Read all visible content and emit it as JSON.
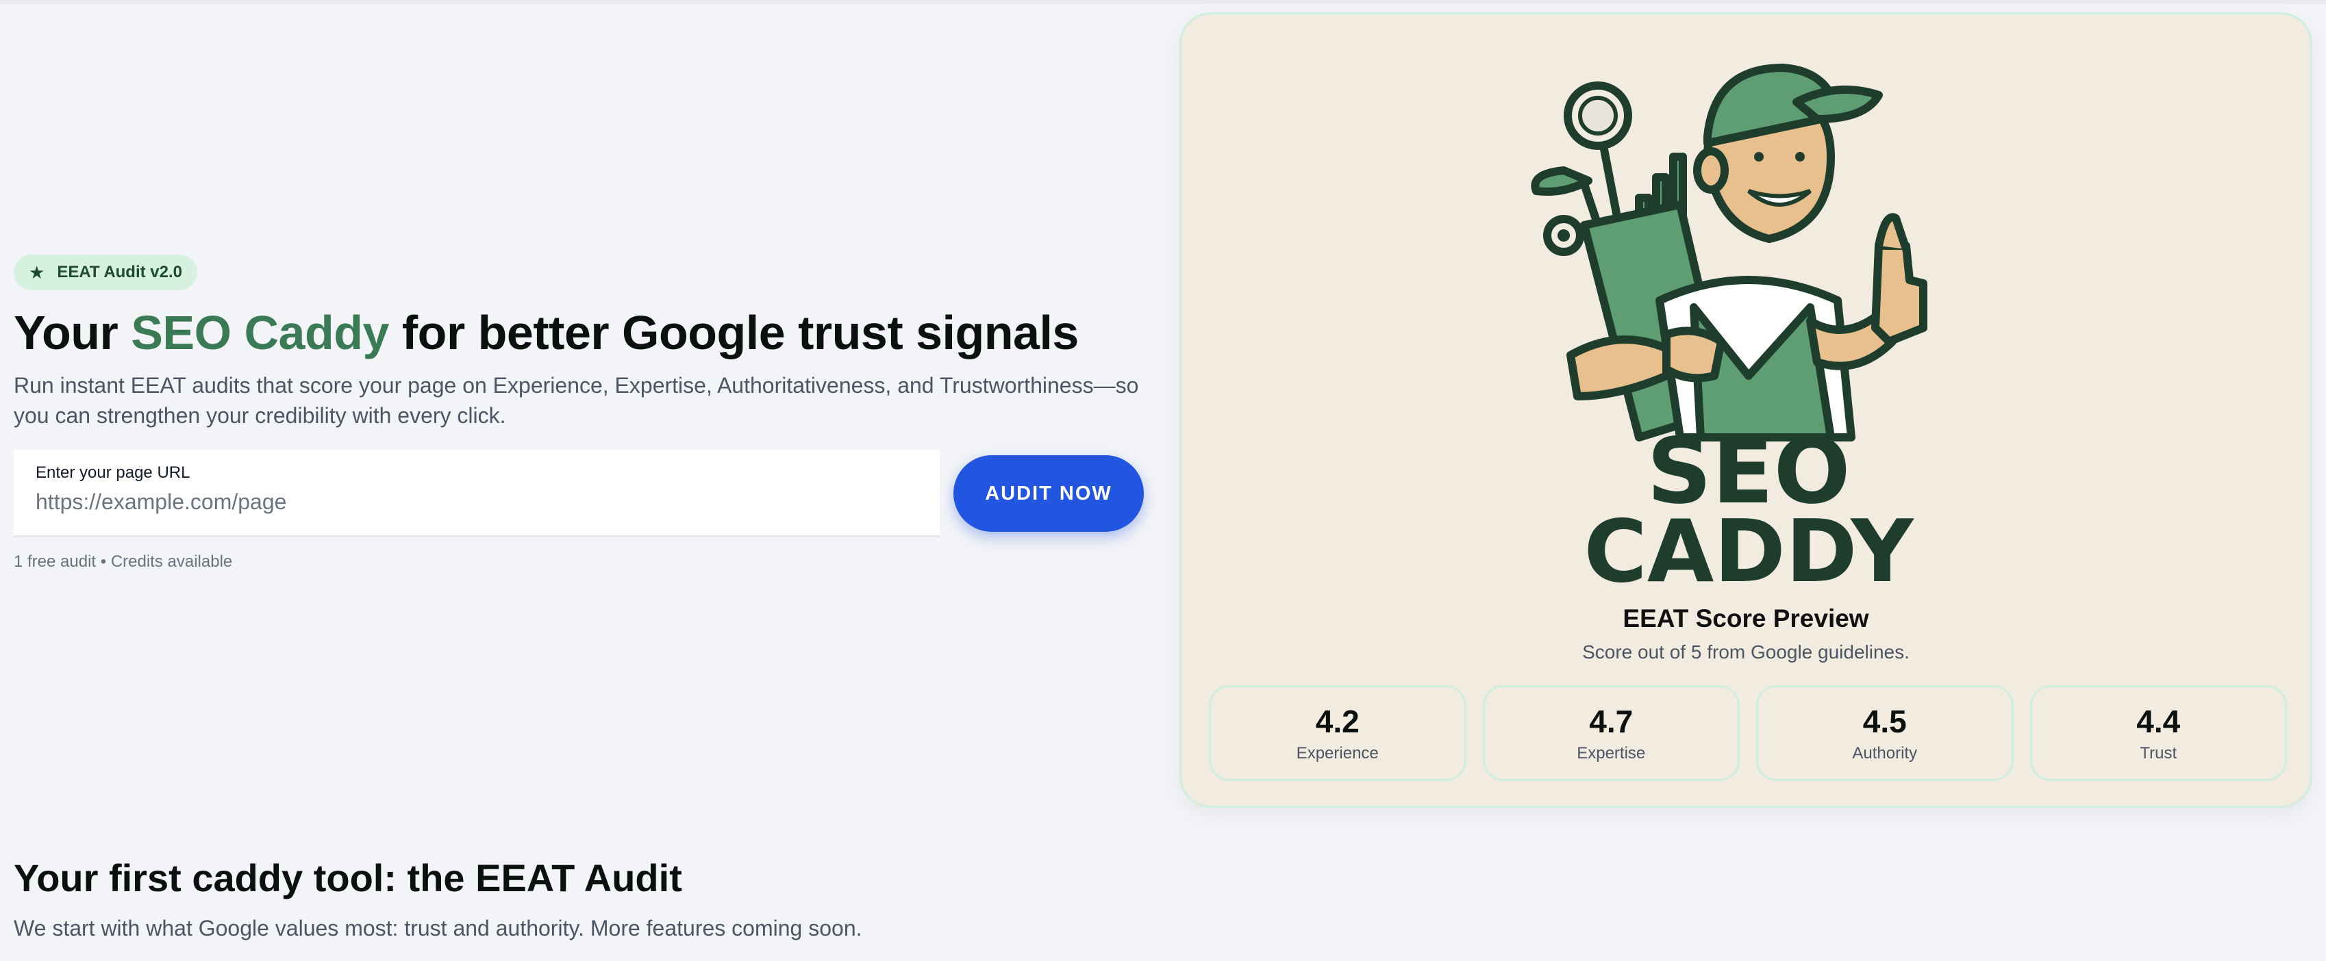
{
  "hero": {
    "badge": "EEAT Audit v2.0",
    "badge_icon": "star-icon",
    "title_pre": "Your ",
    "title_accent": "SEO Caddy",
    "title_post": " for better Google trust signals",
    "subtitle": "Run instant EEAT audits that score your page on Experience, Expertise, Authoritativeness, and Trustworthiness—so you can strengthen your credibility with every click.",
    "url_label": "Enter your page URL",
    "url_placeholder": "https://example.com/page",
    "url_value": "",
    "audit_button": "AUDIT NOW",
    "credits": "1 free audit • Credits available"
  },
  "card": {
    "logo_line1": "SEO",
    "logo_line2": "CADDY",
    "preview_title": "EEAT Score Preview",
    "preview_sub": "Score out of 5 from Google guidelines.",
    "scores": [
      {
        "value": "4.2",
        "label": "Experience"
      },
      {
        "value": "4.7",
        "label": "Expertise"
      },
      {
        "value": "4.5",
        "label": "Authority"
      },
      {
        "value": "4.4",
        "label": "Trust"
      }
    ]
  },
  "section": {
    "title": "Your first caddy tool: the EEAT Audit",
    "subtitle": "We start with what Google values most: trust and authority. More features coming soon."
  },
  "colors": {
    "accent_green": "#3a7b55",
    "dark_green": "#1f4a34",
    "button_blue": "#2255e0",
    "card_bg": "#f2ebe0",
    "page_bg": "#f3f4f7"
  }
}
